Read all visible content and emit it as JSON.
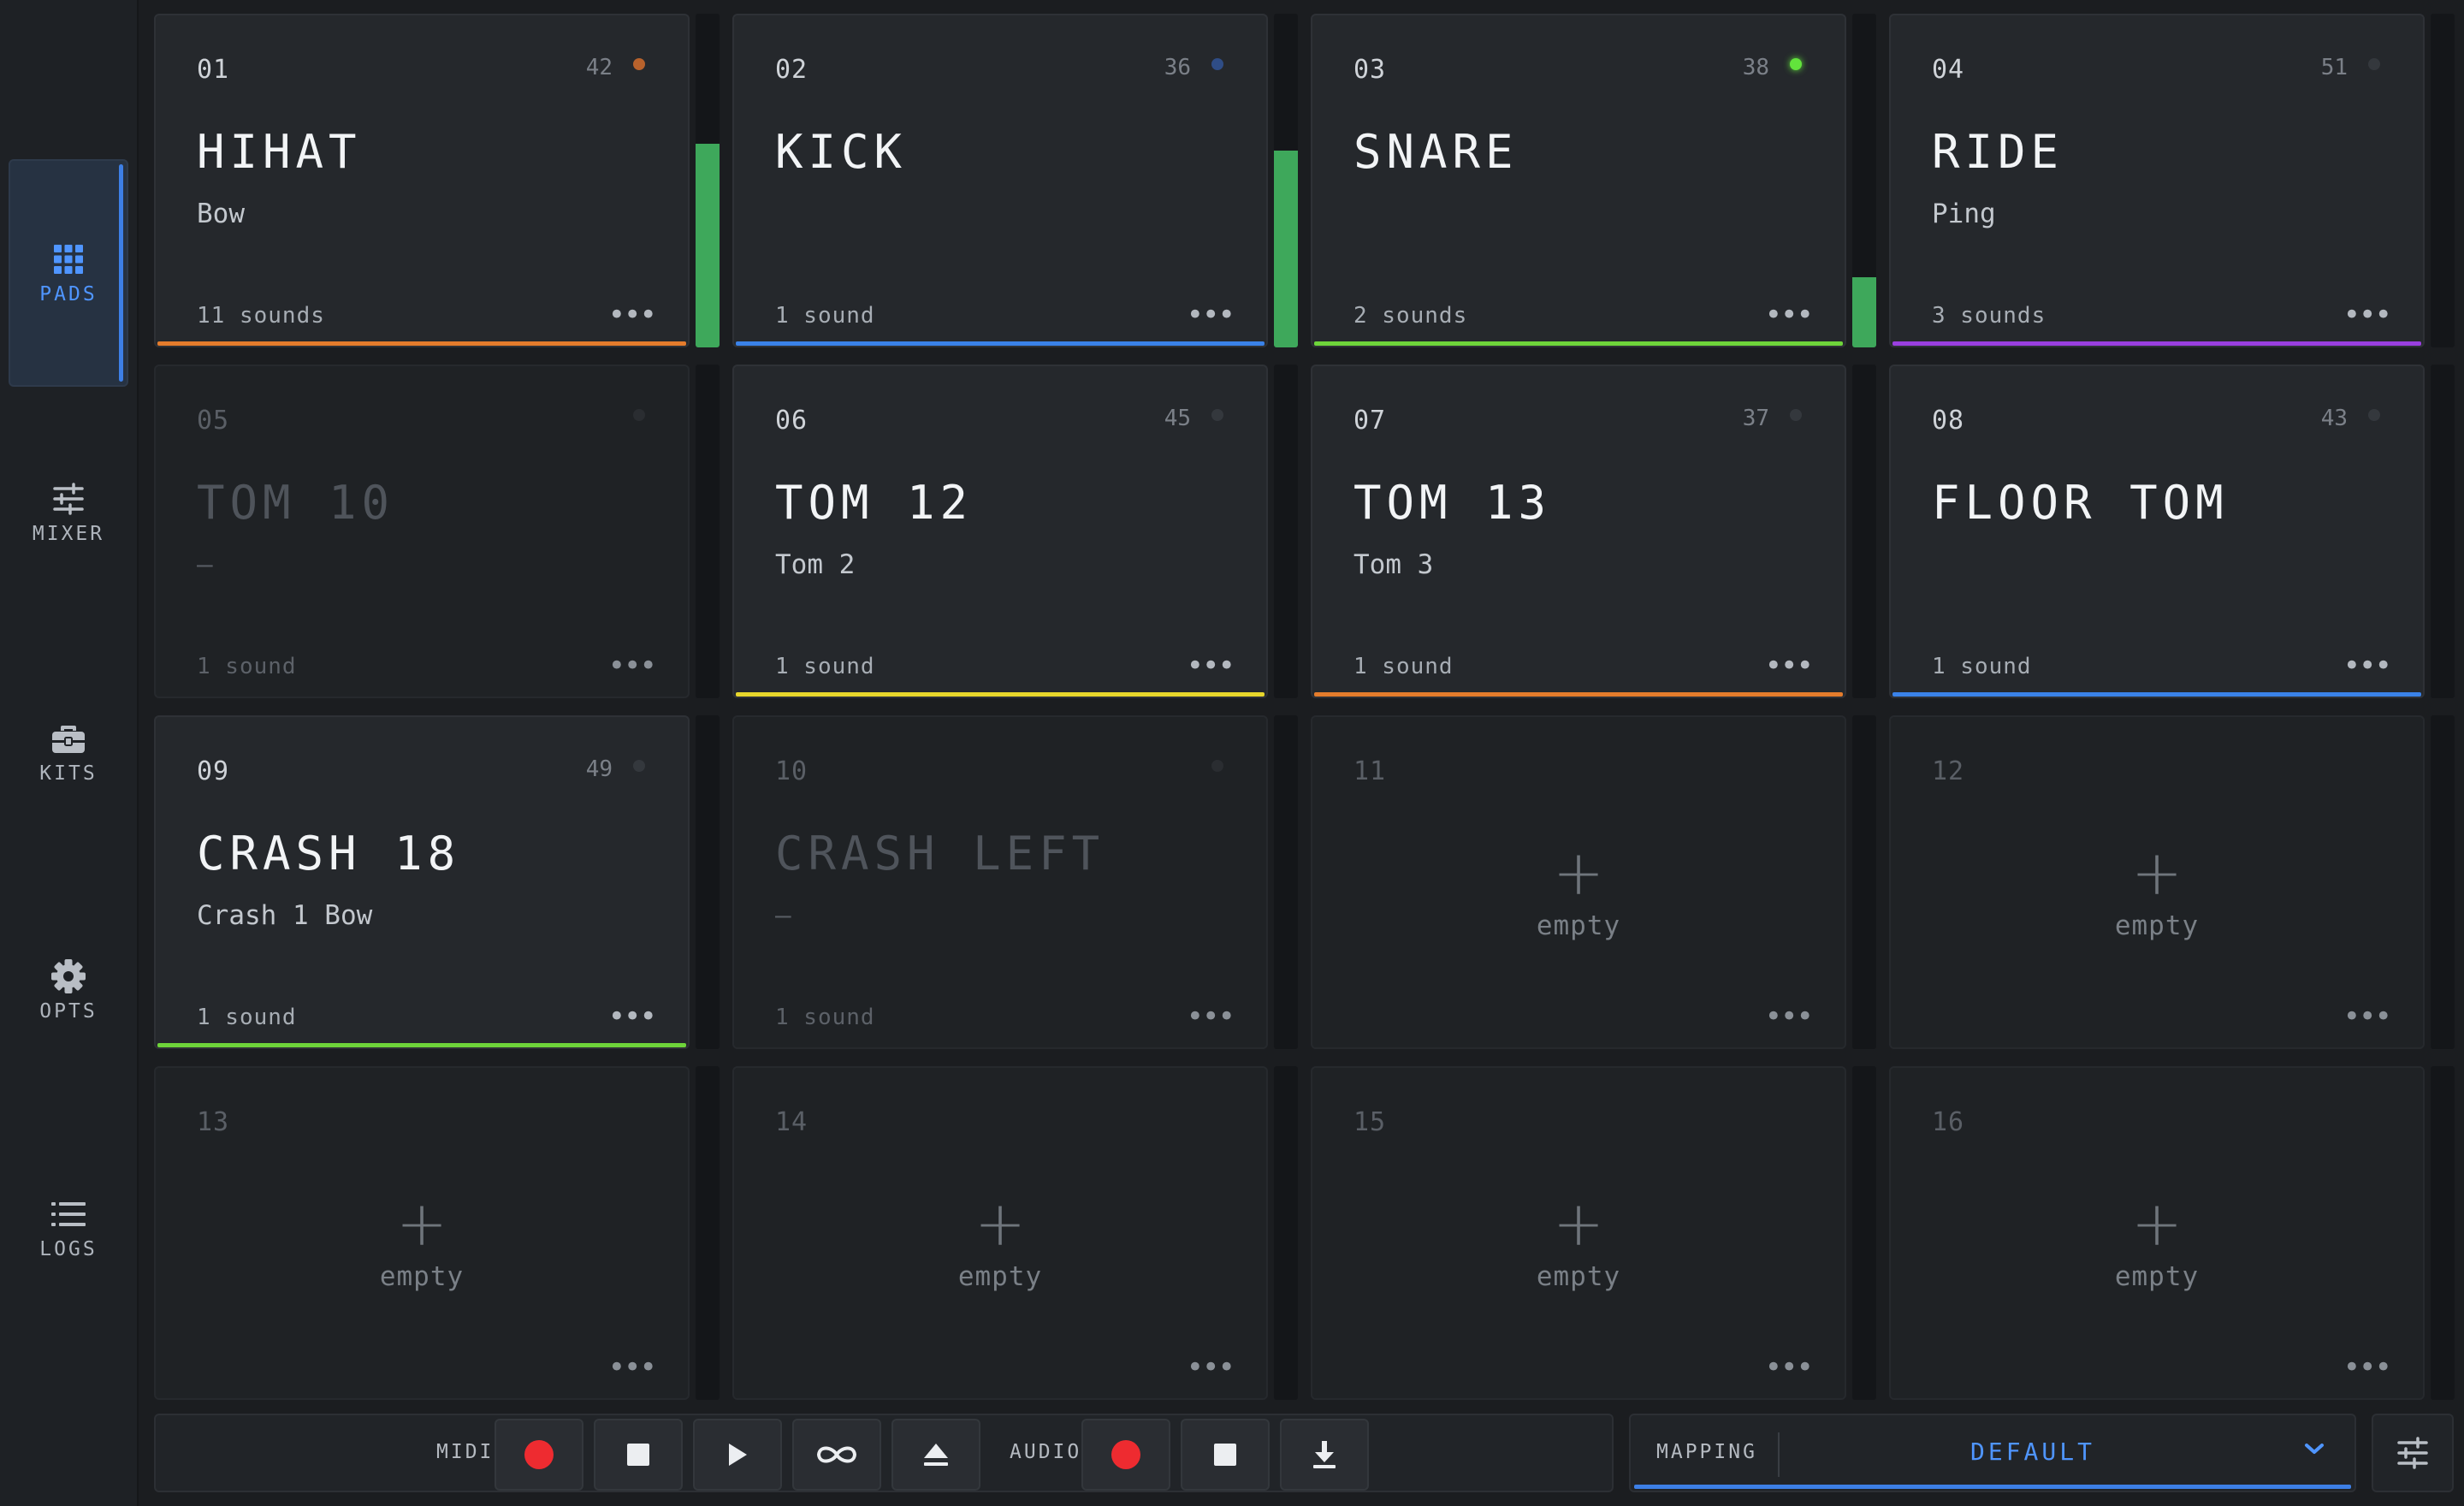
{
  "sidebar": {
    "items": [
      {
        "label": "PADS",
        "icon": "grid-icon",
        "active": true
      },
      {
        "label": "MIXER",
        "icon": "sliders-icon",
        "active": false
      },
      {
        "label": "KITS",
        "icon": "briefcase-icon",
        "active": false
      },
      {
        "label": "OPTS",
        "icon": "gear-icon",
        "active": false
      },
      {
        "label": "LOGS",
        "icon": "list-icon",
        "active": false
      }
    ]
  },
  "pads": [
    {
      "num": "01",
      "note": "42",
      "name": "HIHAT",
      "sub": "Bow",
      "count": "11 sounds",
      "accent": "#e47c2c",
      "led": "#b8622c",
      "meter": 0.61,
      "dim": false
    },
    {
      "num": "02",
      "note": "36",
      "name": "KICK",
      "sub": "",
      "count": "1 sound",
      "accent": "#3a82e8",
      "led": "#2f4d86",
      "meter": 0.59,
      "dim": false
    },
    {
      "num": "03",
      "note": "38",
      "name": "SNARE",
      "sub": "",
      "count": "2 sounds",
      "accent": "#6ed43a",
      "led": "#62e33c",
      "meter": 0.21,
      "dim": false
    },
    {
      "num": "04",
      "note": "51",
      "name": "RIDE",
      "sub": "Ping",
      "count": "3 sounds",
      "accent": "#9a3fe0",
      "led": "#34383d",
      "meter": 0,
      "dim": false
    },
    {
      "num": "05",
      "note": "",
      "name": "TOM 10",
      "sub": "–",
      "count": "1 sound",
      "accent": "",
      "led": "#2a2d31",
      "meter": 0,
      "dim": true
    },
    {
      "num": "06",
      "note": "45",
      "name": "TOM 12",
      "sub": "Tom 2",
      "count": "1 sound",
      "accent": "#e7d62c",
      "led": "#34383d",
      "meter": 0,
      "dim": false
    },
    {
      "num": "07",
      "note": "37",
      "name": "TOM 13",
      "sub": "Tom 3",
      "count": "1 sound",
      "accent": "#e47c2c",
      "led": "#34383d",
      "meter": 0,
      "dim": false
    },
    {
      "num": "08",
      "note": "43",
      "name": "FLOOR TOM",
      "sub": "",
      "count": "1 sound",
      "accent": "#3a82e8",
      "led": "#34383d",
      "meter": 0,
      "dim": false
    },
    {
      "num": "09",
      "note": "49",
      "name": "CRASH 18",
      "sub": "Crash 1 Bow",
      "count": "1 sound",
      "accent": "#6ed43a",
      "led": "#34383d",
      "meter": 0,
      "dim": false
    },
    {
      "num": "10",
      "note": "",
      "name": "CRASH LEFT",
      "sub": "–",
      "count": "1 sound",
      "accent": "",
      "led": "#2a2d31",
      "meter": 0,
      "dim": true
    },
    {
      "num": "11",
      "empty": true,
      "empty_label": "empty",
      "plus": "+"
    },
    {
      "num": "12",
      "empty": true,
      "empty_label": "empty",
      "plus": "+"
    },
    {
      "num": "13",
      "empty": true,
      "empty_label": "empty",
      "plus": "+"
    },
    {
      "num": "14",
      "empty": true,
      "empty_label": "empty",
      "plus": "+"
    },
    {
      "num": "15",
      "empty": true,
      "empty_label": "empty",
      "plus": "+"
    },
    {
      "num": "16",
      "empty": true,
      "empty_label": "empty",
      "plus": "+"
    }
  ],
  "more_glyph": "•••",
  "transport": {
    "midi_label": "MIDI",
    "audio_label": "AUDIO",
    "buttons": [
      "midi-record",
      "midi-stop",
      "midi-play",
      "midi-loop",
      "midi-eject",
      "audio-record",
      "audio-stop",
      "audio-download"
    ]
  },
  "mapping": {
    "label": "MAPPING",
    "value": "DEFAULT"
  },
  "colors": {
    "accent_blue": "#4f95ff",
    "record_red": "#ee2b30",
    "meter_green": "#3ea85b"
  }
}
